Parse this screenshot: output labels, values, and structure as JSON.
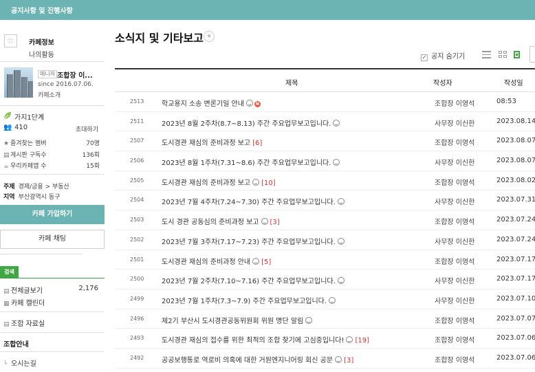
{
  "topbar": {
    "title": "공지사항 및 진행사항"
  },
  "sidebar": {
    "profile_icon": "star-icon",
    "cafe_info_label": "카페정보",
    "my_activity_label": "나의활동",
    "manager_tag": "매니저",
    "manager_name": "조합장 이...",
    "since": "since 2016.07.06.",
    "cafe_intro": "카페소개",
    "level": "가지1단계",
    "member_count": "410",
    "invite_label": "초대하기",
    "stats": [
      {
        "icon": "star-icon",
        "label": "즐겨찾는 멤버",
        "value": "70명"
      },
      {
        "icon": "board-icon",
        "label": "게시판 구독수",
        "value": "136회"
      },
      {
        "icon": "cup-icon",
        "label": "우리카페앱 수",
        "value": "15회"
      }
    ],
    "topic_label": "주제",
    "topic_value": "경제/금융 > 부동산",
    "region_label": "지역",
    "region_value": "부산광역시 동구",
    "join_button": "카페 가입하기",
    "chat_button": "카페 채팅",
    "search_tag": "검색",
    "menu": [
      {
        "icon": "board-icon",
        "label": "전체글보기",
        "count": "2,176"
      },
      {
        "icon": "calendar-icon",
        "label": "카페 캘린더",
        "count": ""
      },
      {
        "icon": "board-icon",
        "label": "조합 자료실",
        "count": ""
      }
    ],
    "section_title": "조합안내",
    "sub_menu": [
      {
        "icon": "sub-branch-icon",
        "label": "오시는길"
      }
    ]
  },
  "main": {
    "page_title": "소식지 및 기타보고",
    "notice_hide_label": "공지 숨기기",
    "columns": {
      "title": "제목",
      "author": "작성자",
      "date": "작성일"
    },
    "posts": [
      {
        "num": "2513",
        "title": "학교용지 소송 변론기일 안내",
        "pic": true,
        "new": "N",
        "comments": "",
        "author": "조합장 이영석",
        "date": "08:53"
      },
      {
        "num": "2511",
        "title": "2023년 8월 2주차(8.7~8.13) 주간 주요업무보고입니다.",
        "pic": true,
        "new": "",
        "comments": "",
        "author": "사무장 이신한",
        "date": "2023.08.14."
      },
      {
        "num": "2507",
        "title": "도시경관 재심의 준비과정 보고",
        "pic": false,
        "new": "",
        "comments": "[6]",
        "author": "조합장 이영석",
        "date": "2023.08.07."
      },
      {
        "num": "2506",
        "title": "2023년 8월 1주차(7.31~8.6) 주간 주요업무보고입니다.",
        "pic": true,
        "new": "",
        "comments": "",
        "author": "사무장 이신한",
        "date": "2023.08.07."
      },
      {
        "num": "2505",
        "title": "도시경관 재심의 준비과정 보고",
        "pic": true,
        "new": "",
        "comments": "[10]",
        "author": "조합장 이영석",
        "date": "2023.08.02."
      },
      {
        "num": "2504",
        "title": "2023년 7월 4주차(7.24~7.30) 주간 주요업무보고입니다.",
        "pic": true,
        "new": "",
        "comments": "",
        "author": "사무장 이신한",
        "date": "2023.07.31."
      },
      {
        "num": "2503",
        "title": "도시 경관 공동심의 준비과정 보고",
        "pic": true,
        "new": "",
        "comments": "[3]",
        "author": "조합장 이영석",
        "date": "2023.07.24."
      },
      {
        "num": "2502",
        "title": "2023년 7월 3주차(7.17~7.23) 주간 주요업무보고입니다.",
        "pic": true,
        "new": "",
        "comments": "",
        "author": "사무장 이신한",
        "date": "2023.07.24."
      },
      {
        "num": "2501",
        "title": "도시경관 재심의 준비과정 안내",
        "pic": true,
        "new": "",
        "comments": "[5]",
        "author": "조합장 이영석",
        "date": "2023.07.17."
      },
      {
        "num": "2500",
        "title": "2023년 7월 2주차(7.10~7.16) 주간 주요업무보고입니다.",
        "pic": true,
        "new": "",
        "comments": "",
        "author": "사무장 이신한",
        "date": "2023.07.17."
      },
      {
        "num": "2499",
        "title": "2023년 7월 1주차(7.3~7.9) 주간 주요업무보고입니다.",
        "pic": true,
        "new": "",
        "comments": "",
        "author": "사무장 이신한",
        "date": "2023.07.10."
      },
      {
        "num": "2496",
        "title": "제2기 부산시 도시경관공동위원회 위원 명단 알림",
        "pic": true,
        "new": "",
        "comments": "",
        "author": "조합장 이영석",
        "date": "2023.07.07."
      },
      {
        "num": "2493",
        "title": "도시경관 재심의 접수를 위한 최적의 조합 찾기에 고심중입니다!",
        "pic": true,
        "new": "",
        "comments": "[19]",
        "author": "조합장 이영석",
        "date": "2023.07.06."
      },
      {
        "num": "2492",
        "title": "공공보행통로 역로비 의혹에 대한 거원엔지니어링 회신 공문",
        "pic": true,
        "new": "",
        "comments": "[3]",
        "author": "조합장 이영석",
        "date": "2023.07.06."
      }
    ]
  }
}
